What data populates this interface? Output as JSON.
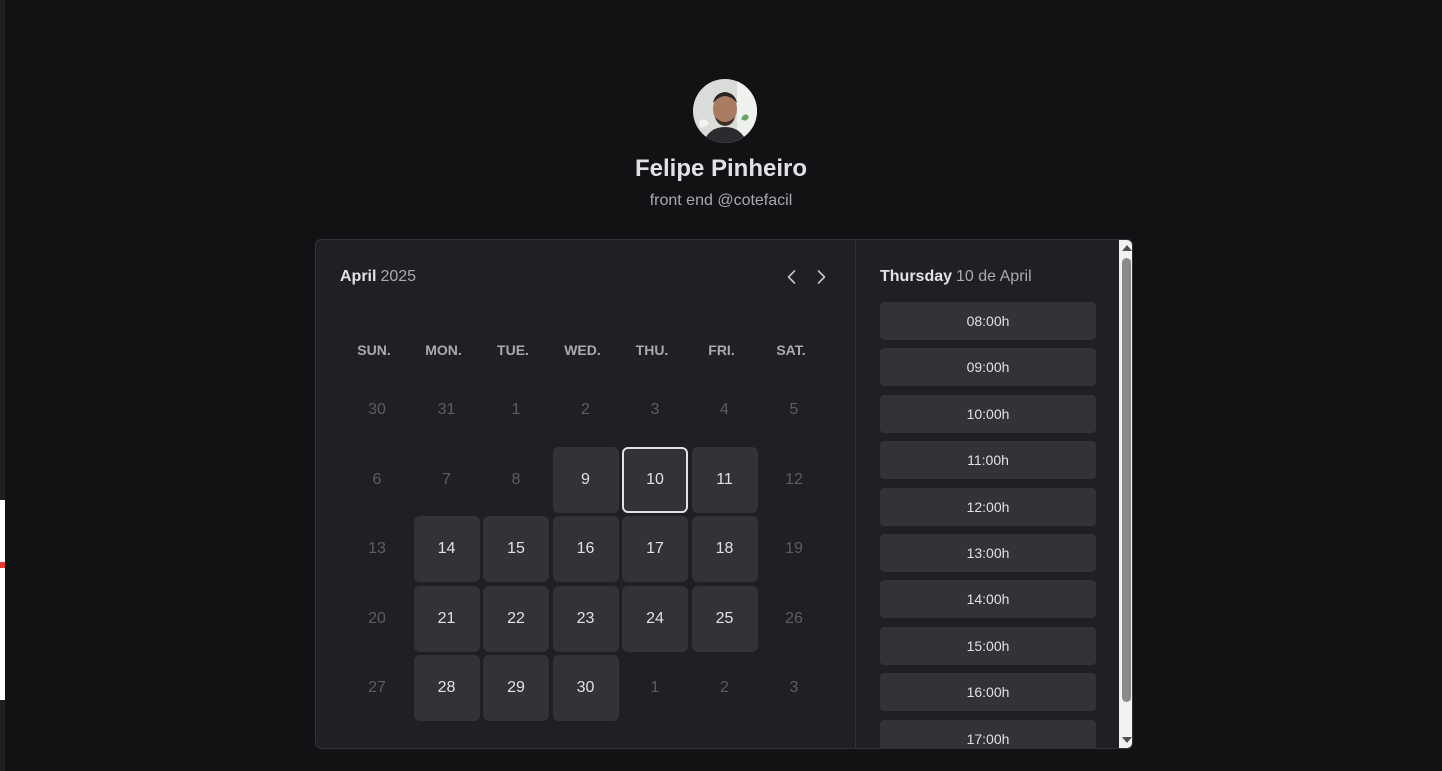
{
  "profile": {
    "name": "Felipe Pinheiro",
    "bio": "front end @cotefacil"
  },
  "calendar": {
    "month": "April",
    "year": "2025",
    "weekdays": [
      "SUN.",
      "MON.",
      "TUE.",
      "WED.",
      "THU.",
      "FRI.",
      "SAT."
    ],
    "weeks": [
      [
        {
          "d": "30",
          "s": "muted"
        },
        {
          "d": "31",
          "s": "muted"
        },
        {
          "d": "1",
          "s": "muted"
        },
        {
          "d": "2",
          "s": "muted"
        },
        {
          "d": "3",
          "s": "muted"
        },
        {
          "d": "4",
          "s": "muted"
        },
        {
          "d": "5",
          "s": "muted"
        }
      ],
      [
        {
          "d": "6",
          "s": "muted"
        },
        {
          "d": "7",
          "s": "muted"
        },
        {
          "d": "8",
          "s": "muted"
        },
        {
          "d": "9",
          "s": "avail"
        },
        {
          "d": "10",
          "s": "selected"
        },
        {
          "d": "11",
          "s": "avail"
        },
        {
          "d": "12",
          "s": "muted"
        }
      ],
      [
        {
          "d": "13",
          "s": "muted"
        },
        {
          "d": "14",
          "s": "avail"
        },
        {
          "d": "15",
          "s": "avail"
        },
        {
          "d": "16",
          "s": "avail"
        },
        {
          "d": "17",
          "s": "avail"
        },
        {
          "d": "18",
          "s": "avail"
        },
        {
          "d": "19",
          "s": "muted"
        }
      ],
      [
        {
          "d": "20",
          "s": "muted"
        },
        {
          "d": "21",
          "s": "avail"
        },
        {
          "d": "22",
          "s": "avail"
        },
        {
          "d": "23",
          "s": "avail"
        },
        {
          "d": "24",
          "s": "avail"
        },
        {
          "d": "25",
          "s": "avail"
        },
        {
          "d": "26",
          "s": "muted"
        }
      ],
      [
        {
          "d": "27",
          "s": "muted"
        },
        {
          "d": "28",
          "s": "avail"
        },
        {
          "d": "29",
          "s": "avail"
        },
        {
          "d": "30",
          "s": "avail"
        },
        {
          "d": "1",
          "s": "muted"
        },
        {
          "d": "2",
          "s": "muted"
        },
        {
          "d": "3",
          "s": "muted"
        }
      ]
    ]
  },
  "times": {
    "weekday": "Thursday",
    "date": "10 de April",
    "slots": [
      "08:00h",
      "09:00h",
      "10:00h",
      "11:00h",
      "12:00h",
      "13:00h",
      "14:00h",
      "15:00h",
      "16:00h",
      "17:00h"
    ]
  },
  "colors": {
    "background": "#121214",
    "card": "#202024",
    "available_day": "#323238",
    "muted_text": "#5c5c63"
  },
  "icons": {
    "prev": "chevron-left-icon",
    "next": "chevron-right-icon"
  }
}
